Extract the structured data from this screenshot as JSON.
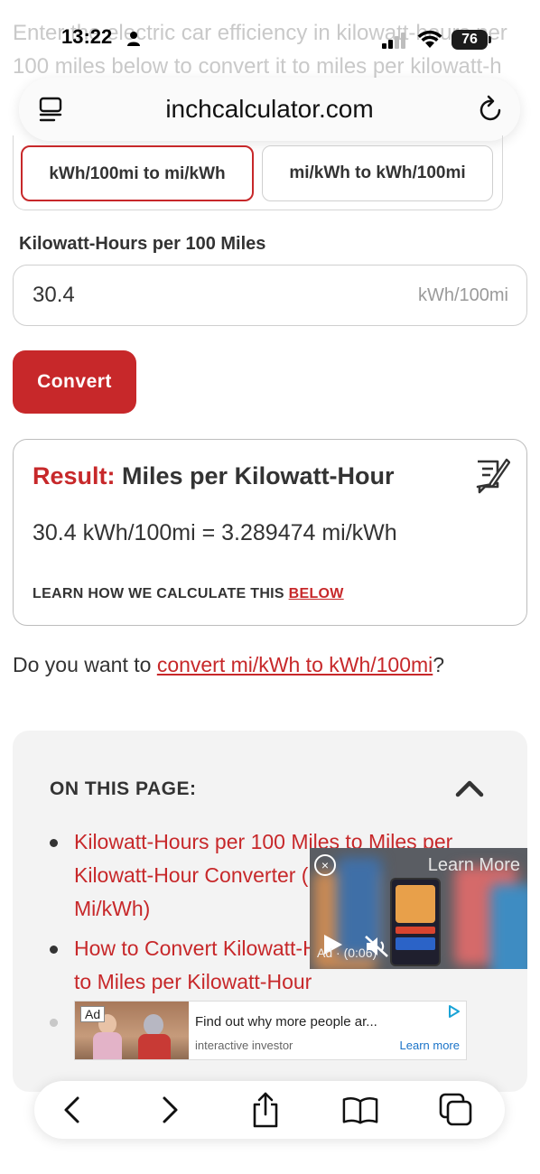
{
  "background_intro": "Enter the electric car efficiency in kilowatt-hours per 100 miles below to convert it to miles per kilowatt-h",
  "status_bar": {
    "time": "13:22",
    "battery": "76"
  },
  "url_bar": {
    "domain": "inchcalculator.com"
  },
  "mode_tabs": [
    {
      "label": "kWh/100mi to mi/kWh",
      "active": true
    },
    {
      "label": "mi/kWh to kWh/100mi",
      "active": false
    }
  ],
  "input": {
    "label": "Kilowatt-Hours per 100 Miles",
    "value": "30.4",
    "unit": "kWh/100mi"
  },
  "convert_label": "Convert",
  "result": {
    "label": "Result:",
    "title": " Miles per Kilowatt-Hour",
    "equation": "30.4 kWh/100mi = 3.289474 mi/kWh",
    "learn_text": "LEARN HOW WE CALCULATE THIS ",
    "learn_link": "BELOW"
  },
  "question": {
    "prefix": "Do you want to ",
    "link": "convert mi/kWh to kWh/100mi",
    "suffix": "?"
  },
  "toc": {
    "title": "ON THIS PAGE:",
    "items": [
      "Kilowatt-Hours per 100 Miles to Miles per Kilowatt-Hour Converter (kWh/100mi to Mi/kWh)",
      "How to Convert Kilowatt-Hours per 100 Miles to Miles per Kilowatt-Hour"
    ]
  },
  "video_ad": {
    "close": "×",
    "learn_more": "Learn More",
    "timer": "Ad · (0:06)"
  },
  "banner_ad": {
    "badge": "Ad",
    "headline": "Find out why more people ar...",
    "source": "interactive investor",
    "cta": "Learn more"
  },
  "toolbar": {
    "buttons": [
      "back-icon",
      "forward-icon",
      "share-icon",
      "bookmarks-icon",
      "tabs-icon"
    ]
  },
  "colors": {
    "accent": "#c7282a",
    "text": "#333333",
    "toc_bg": "#f3f3f3",
    "link_blue": "#1a73c8"
  }
}
